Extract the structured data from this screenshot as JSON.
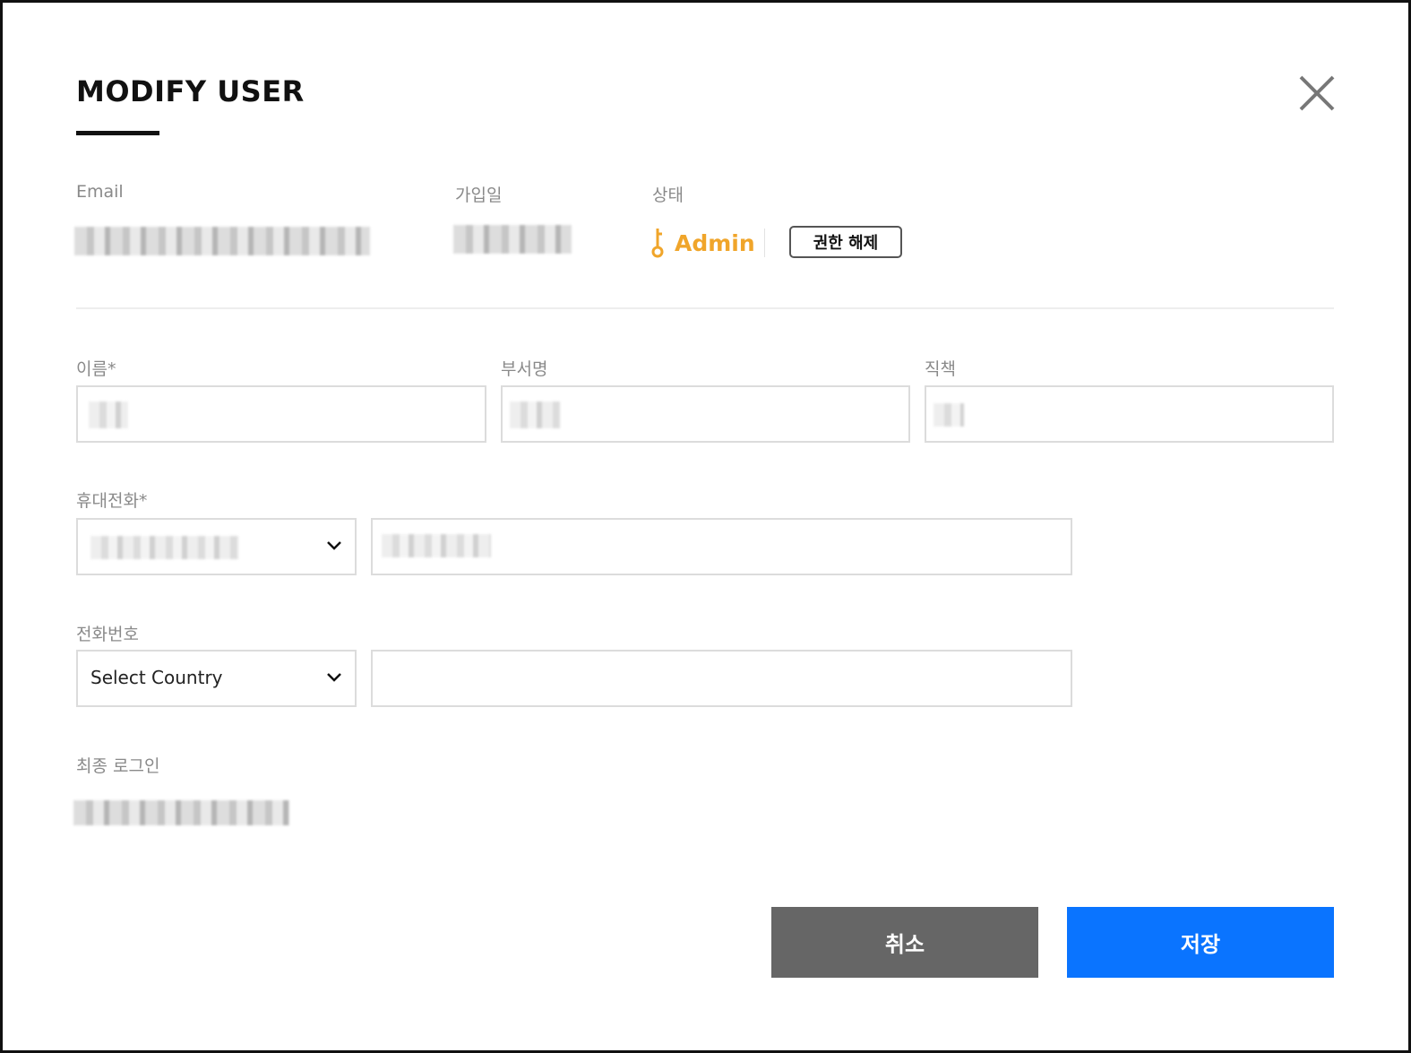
{
  "dialog": {
    "title": "MODIFY USER"
  },
  "info": {
    "email_label": "Email",
    "joined_label": "가입일",
    "status_label": "상태",
    "status_value": "Admin",
    "revoke_label": "권한 해제"
  },
  "form": {
    "name_label": "이름*",
    "dept_label": "부서명",
    "position_label": "직책",
    "mobile_label": "휴대전화*",
    "phone_label": "전화번호",
    "phone_country_placeholder": "Select Country",
    "last_login_label": "최종 로그인"
  },
  "actions": {
    "cancel_label": "취소",
    "save_label": "저장"
  },
  "colors": {
    "accent": "#0a74ff",
    "admin": "#f0a52a",
    "cancel": "#666666"
  }
}
